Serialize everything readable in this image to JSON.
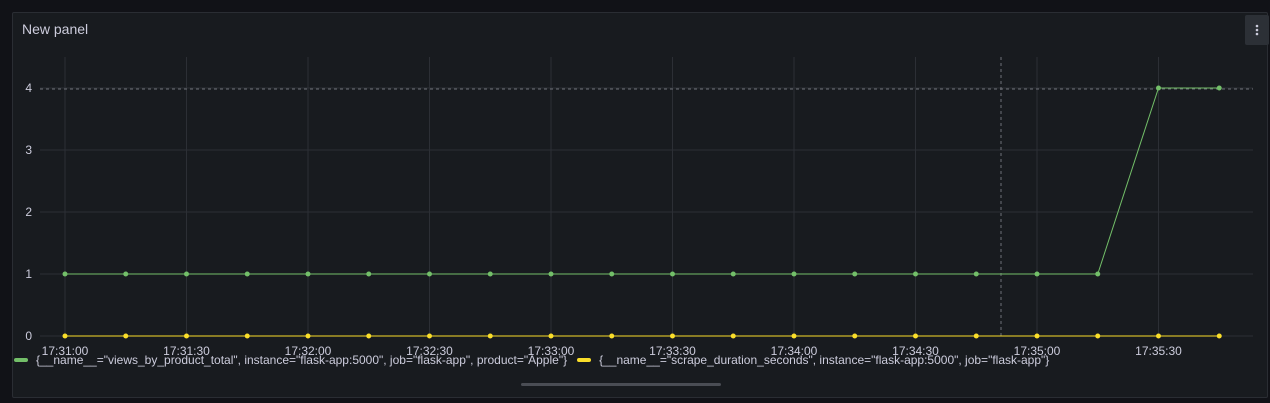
{
  "panel": {
    "title": "New panel"
  },
  "icons": {
    "menu": "more-vertical-icon"
  },
  "colors": {
    "series1": "#73bf69",
    "series2": "#fade2a",
    "grid": "#2c2f35",
    "axis_text": "#ccccdc"
  },
  "chart_data": {
    "type": "line",
    "x": [
      "17:31:00",
      "17:31:15",
      "17:31:30",
      "17:31:45",
      "17:32:00",
      "17:32:15",
      "17:32:30",
      "17:32:45",
      "17:33:00",
      "17:33:15",
      "17:33:30",
      "17:33:45",
      "17:34:00",
      "17:34:15",
      "17:34:30",
      "17:34:45",
      "17:35:00",
      "17:35:15",
      "17:35:30",
      "17:35:45"
    ],
    "x_tick_labels": [
      "17:31:00",
      "17:31:30",
      "17:32:00",
      "17:32:30",
      "17:33:00",
      "17:33:30",
      "17:34:00",
      "17:34:30",
      "17:35:00",
      "17:35:30"
    ],
    "y_tick_labels": [
      "0",
      "1",
      "2",
      "3",
      "4"
    ],
    "ylim": [
      0,
      4.4
    ],
    "grid": true,
    "legend_position": "bottom",
    "series": [
      {
        "name": "{__name__=\"views_by_product_total\", instance=\"flask-app:5000\", job=\"flask-app\", product=\"Apple\"}",
        "color": "#73bf69",
        "values": [
          1,
          1,
          1,
          1,
          1,
          1,
          1,
          1,
          1,
          1,
          1,
          1,
          1,
          1,
          1,
          1,
          1,
          1,
          4,
          4
        ]
      },
      {
        "name": "{__name__=\"scrape_duration_seconds\", instance=\"flask-app:5000\", job=\"flask-app\"}",
        "color": "#fade2a",
        "values": [
          0,
          0,
          0,
          0,
          0,
          0,
          0,
          0,
          0,
          0,
          0,
          0,
          0,
          0,
          0,
          0,
          0,
          0,
          0,
          0
        ]
      }
    ]
  }
}
